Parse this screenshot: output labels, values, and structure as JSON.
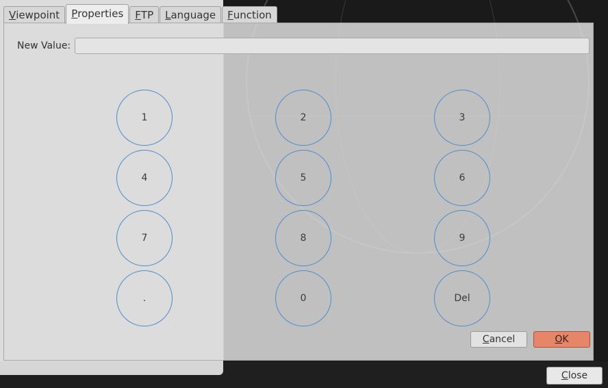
{
  "tabs": [
    {
      "mn": "V",
      "rest": "iewpoint",
      "active": false
    },
    {
      "mn": "P",
      "rest": "roperties",
      "active": true
    },
    {
      "mn": "F",
      "rest": "TP",
      "active": false
    },
    {
      "mn": "L",
      "rest": "anguage",
      "active": false
    },
    {
      "mn": "F",
      "rest": "unction",
      "active": false
    }
  ],
  "form": {
    "new_value_label": "New Value:",
    "new_value": ""
  },
  "keypad": {
    "keys": [
      "1",
      "2",
      "3",
      "4",
      "5",
      "6",
      "7",
      "8",
      "9",
      ".",
      "0",
      "Del"
    ]
  },
  "buttons": {
    "cancel_mn": "C",
    "cancel_rest": "ancel",
    "ok_mn": "O",
    "ok_rest": "K",
    "close_mn": "C",
    "close_rest": "lose"
  },
  "colors": {
    "accent_ok": "#e5866a",
    "key_border": "#4a8ccd"
  }
}
